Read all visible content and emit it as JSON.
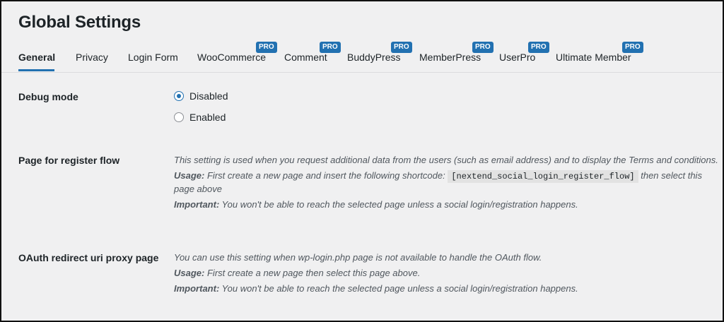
{
  "page": {
    "title": "Global Settings"
  },
  "tabs": [
    {
      "label": "General",
      "active": true,
      "pro": false
    },
    {
      "label": "Privacy",
      "active": false,
      "pro": false
    },
    {
      "label": "Login Form",
      "active": false,
      "pro": false
    },
    {
      "label": "WooCommerce",
      "active": false,
      "pro": true
    },
    {
      "label": "Comment",
      "active": false,
      "pro": true
    },
    {
      "label": "BuddyPress",
      "active": false,
      "pro": true
    },
    {
      "label": "MemberPress",
      "active": false,
      "pro": true
    },
    {
      "label": "UserPro",
      "active": false,
      "pro": true
    },
    {
      "label": "Ultimate Member",
      "active": false,
      "pro": true
    }
  ],
  "pro_badge": "PRO",
  "accent_color": "#2271b1",
  "settings": {
    "debug_mode": {
      "label": "Debug mode",
      "options": [
        {
          "label": "Disabled",
          "selected": true
        },
        {
          "label": "Enabled",
          "selected": false
        }
      ]
    },
    "register_flow": {
      "label": "Page for register flow",
      "line1": "This setting is used when you request additional data from the users (such as email address) and to display the Terms and conditions.",
      "usage_label": "Usage:",
      "usage_text": "First create a new page and insert the following shortcode:",
      "shortcode": "[nextend_social_login_register_flow]",
      "usage_after": "then select this page above",
      "important_label": "Important:",
      "important_text": "You won't be able to reach the selected page unless a social login/registration happens."
    },
    "oauth_proxy": {
      "label": "OAuth redirect uri proxy page",
      "line1": "You can use this setting when wp-login.php page is not available to handle the OAuth flow.",
      "usage_label": "Usage:",
      "usage_text": "First create a new page then select this page above.",
      "important_label": "Important:",
      "important_text": "You won't be able to reach the selected page unless a social login/registration happens."
    }
  }
}
